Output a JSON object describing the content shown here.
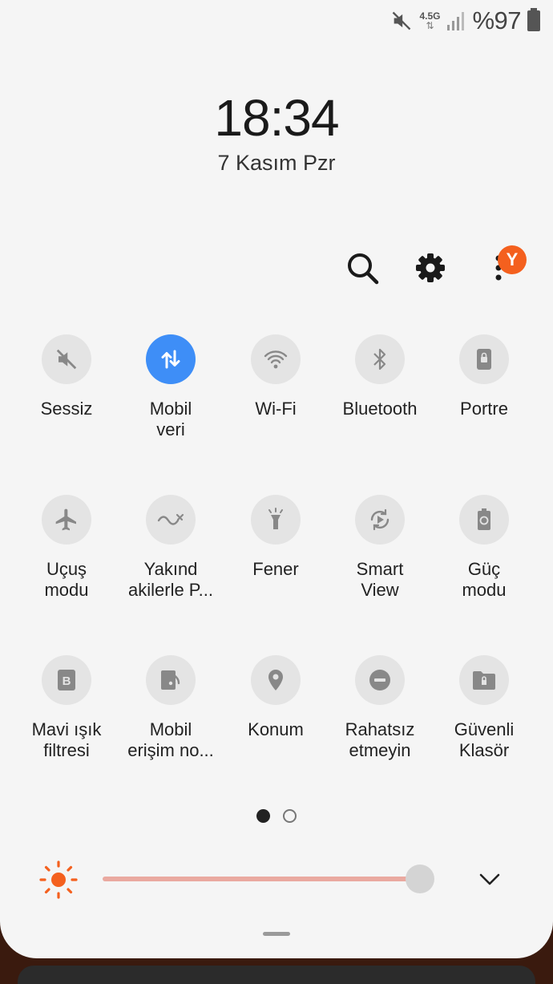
{
  "status_bar": {
    "network_type": "4.5G",
    "network_arrows": "⇅",
    "battery_text": "%97"
  },
  "clock": {
    "time": "18:34",
    "date": "7 Kasım Pzr"
  },
  "header": {
    "avatar_letter": "Y"
  },
  "tiles": [
    {
      "label": "Sessiz",
      "icon": "mute-icon",
      "active": false
    },
    {
      "label": "Mobil\nveri",
      "icon": "mobile-data-icon",
      "active": true
    },
    {
      "label": "Wi-Fi",
      "icon": "wifi-icon",
      "active": false
    },
    {
      "label": "Bluetooth",
      "icon": "bluetooth-icon",
      "active": false
    },
    {
      "label": "Portre",
      "icon": "portrait-lock-icon",
      "active": false
    },
    {
      "label": "Uçuş\nmodu",
      "icon": "airplane-icon",
      "active": false
    },
    {
      "label": "Yakınd\nakilerle P...",
      "icon": "nearby-share-icon",
      "active": false
    },
    {
      "label": "Fener",
      "icon": "flashlight-icon",
      "active": false
    },
    {
      "label": "Smart\nView",
      "icon": "smart-view-icon",
      "active": false
    },
    {
      "label": "Güç\nmodu",
      "icon": "power-mode-icon",
      "active": false
    },
    {
      "label": "Mavi ışık\nfiltresi",
      "icon": "blue-light-filter-icon",
      "active": false
    },
    {
      "label": "Mobil\nerişim no...",
      "icon": "mobile-hotspot-icon",
      "active": false
    },
    {
      "label": "Konum",
      "icon": "location-icon",
      "active": false
    },
    {
      "label": "Rahatsız\netmeyin",
      "icon": "do-not-disturb-icon",
      "active": false
    },
    {
      "label": "Güvenli\nKlasör",
      "icon": "secure-folder-icon",
      "active": false
    }
  ],
  "paging": {
    "current": 1,
    "total": 2
  },
  "brightness": {
    "level": 0.96
  },
  "colors": {
    "accent": "#3e8ef7",
    "avatar": "#f4601e",
    "brightness_track": "#eaa9a0",
    "sun": "#f4601e"
  }
}
